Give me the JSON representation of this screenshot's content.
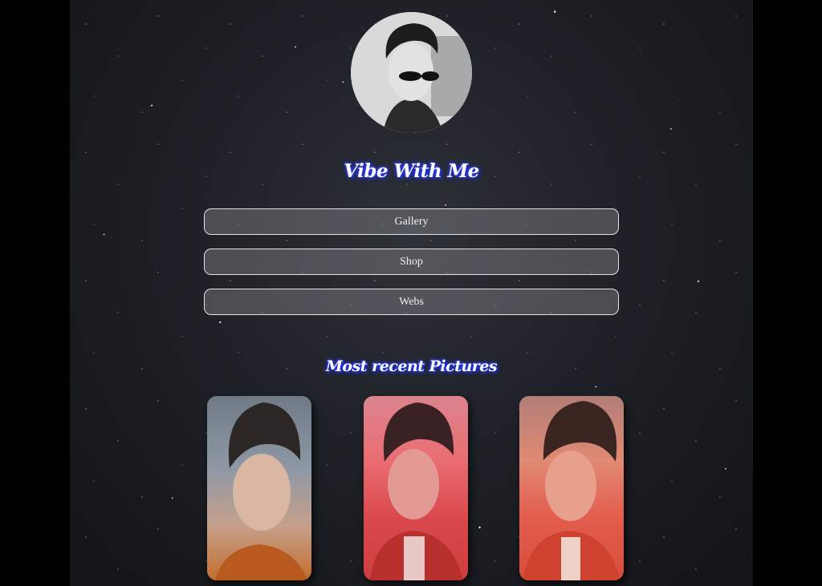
{
  "profile": {
    "title": "Vibe With Me"
  },
  "nav": {
    "items": [
      {
        "label": "Gallery"
      },
      {
        "label": "Shop"
      },
      {
        "label": "Webs"
      }
    ]
  },
  "recent": {
    "heading": "Most recent Pictures"
  },
  "colors": {
    "page_background": "#1e2127",
    "outer_background": "#000000",
    "title_glow": "#2a3cff",
    "button_border": "#ffffff"
  }
}
